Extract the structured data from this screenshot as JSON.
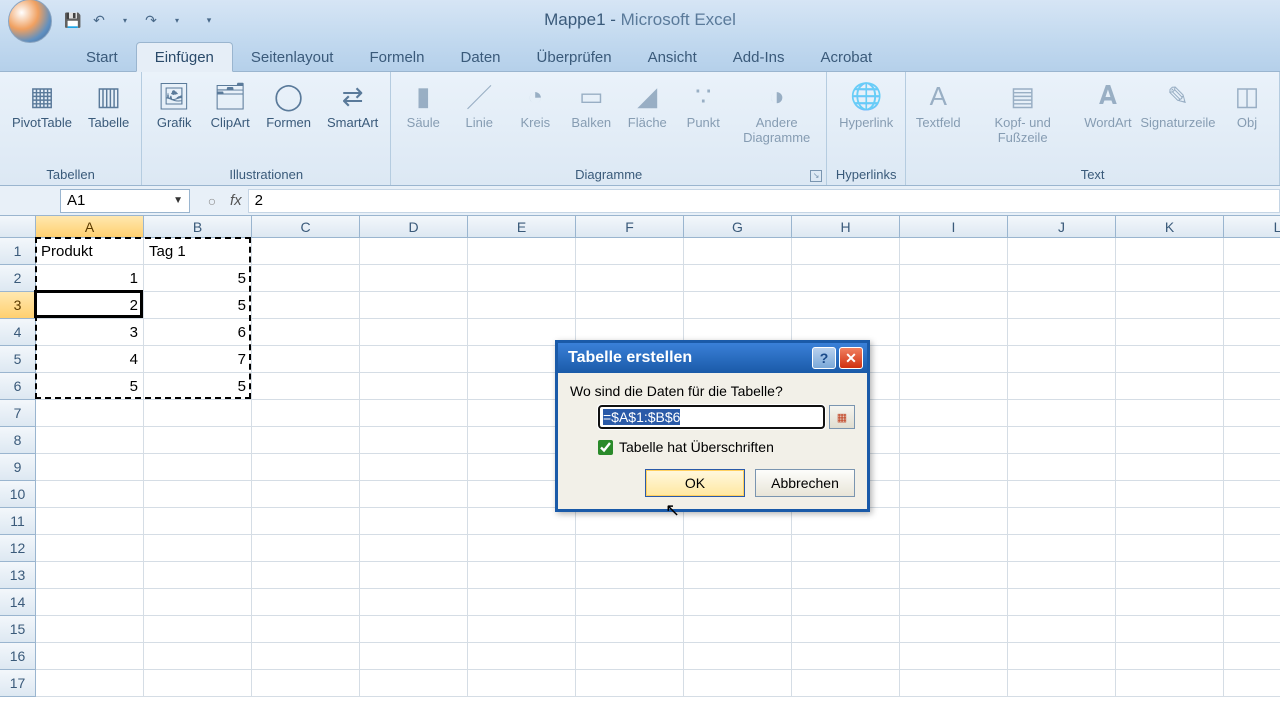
{
  "title": {
    "doc": "Mappe1",
    "app": "Microsoft Excel"
  },
  "tabs": [
    "Start",
    "Einfügen",
    "Seitenlayout",
    "Formeln",
    "Daten",
    "Überprüfen",
    "Ansicht",
    "Add-Ins",
    "Acrobat"
  ],
  "active_tab": 1,
  "ribbon": {
    "groups": [
      {
        "label": "Tabellen",
        "items": [
          {
            "name": "pivottable",
            "label": "PivotTable",
            "glyph": "▦"
          },
          {
            "name": "tabelle",
            "label": "Tabelle",
            "glyph": "▥"
          }
        ]
      },
      {
        "label": "Illustrationen",
        "items": [
          {
            "name": "grafik",
            "label": "Grafik",
            "glyph": "🖼"
          },
          {
            "name": "clipart",
            "label": "ClipArt",
            "glyph": "🗂"
          },
          {
            "name": "formen",
            "label": "Formen",
            "glyph": "◯"
          },
          {
            "name": "smartart",
            "label": "SmartArt",
            "glyph": "⇄"
          }
        ]
      },
      {
        "label": "Diagramme",
        "launcher": true,
        "disabled": true,
        "items": [
          {
            "name": "saeule",
            "label": "Säule",
            "glyph": "▮"
          },
          {
            "name": "linie",
            "label": "Linie",
            "glyph": "／"
          },
          {
            "name": "kreis",
            "label": "Kreis",
            "glyph": "◔"
          },
          {
            "name": "balken",
            "label": "Balken",
            "glyph": "▭"
          },
          {
            "name": "flaeche",
            "label": "Fläche",
            "glyph": "◢"
          },
          {
            "name": "punkt",
            "label": "Punkt",
            "glyph": "∵"
          },
          {
            "name": "andere",
            "label": "Andere Diagramme",
            "glyph": "◑"
          }
        ]
      },
      {
        "label": "Hyperlinks",
        "disabled": true,
        "items": [
          {
            "name": "hyperlink",
            "label": "Hyperlink",
            "glyph": "🌐"
          }
        ]
      },
      {
        "label": "Text",
        "disabled": true,
        "items": [
          {
            "name": "textfeld",
            "label": "Textfeld",
            "glyph": "A"
          },
          {
            "name": "kopfzeile",
            "label": "Kopf- und Fußzeile",
            "glyph": "▤"
          },
          {
            "name": "wordart",
            "label": "WordArt",
            "glyph": "𝐀"
          },
          {
            "name": "signatur",
            "label": "Signaturzeile",
            "glyph": "✎"
          },
          {
            "name": "objekt",
            "label": "Obj",
            "glyph": "◫"
          }
        ]
      }
    ]
  },
  "namebox": "A1",
  "formula": "2",
  "columns": [
    "A",
    "B",
    "C",
    "D",
    "E",
    "F",
    "G",
    "H",
    "I",
    "J",
    "K",
    "L"
  ],
  "selected_col": 0,
  "row_count": 17,
  "selected_row": 2,
  "data": {
    "A1": "Produkt",
    "B1": "Tag 1",
    "A2": "1",
    "B2": "5",
    "A3": "2",
    "B3": "5",
    "A4": "3",
    "B4": "6",
    "A5": "4",
    "B5": "7",
    "A6": "5",
    "B6": "5"
  },
  "marching_range": {
    "c1": 0,
    "r1": 0,
    "c2": 1,
    "r2": 5
  },
  "active_cell": {
    "c": 0,
    "r": 2
  },
  "dialog": {
    "title": "Tabelle erstellen",
    "prompt": "Wo sind die Daten für die Tabelle?",
    "range_value": "=$A$1:$B$6",
    "checkbox_label": "Tabelle hat Überschriften",
    "checkbox_checked": true,
    "ok": "OK",
    "cancel": "Abbrechen"
  }
}
